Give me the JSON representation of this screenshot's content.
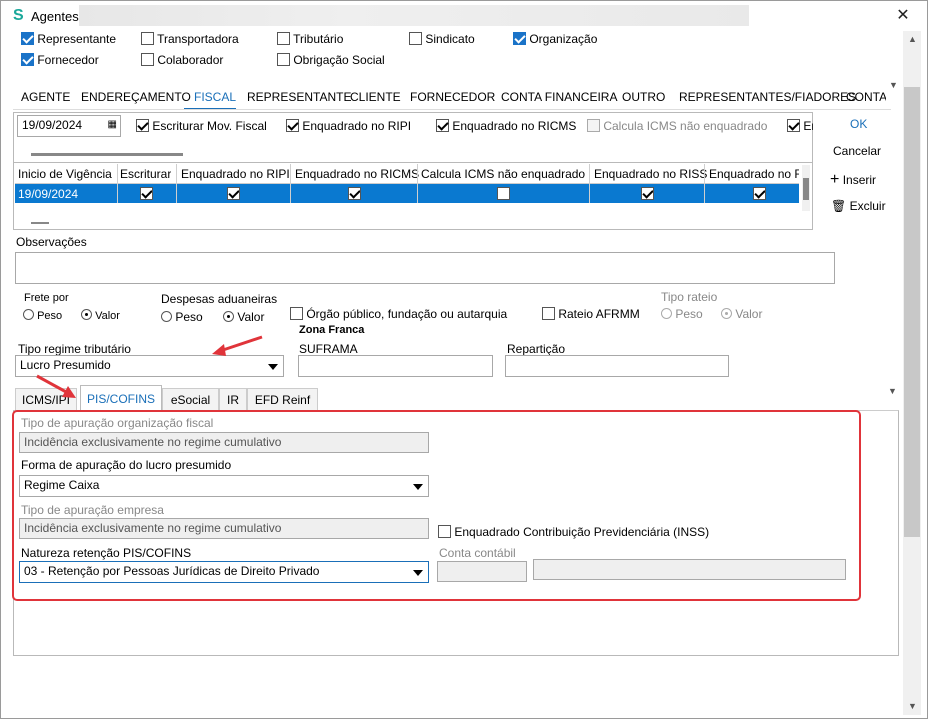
{
  "window": {
    "title": "Agentes"
  },
  "top_checks": [
    {
      "label": "Representante",
      "checked": true
    },
    {
      "label": "Transportadora",
      "checked": false
    },
    {
      "label": "Tributário",
      "checked": false
    },
    {
      "label": "Sindicato",
      "checked": false
    },
    {
      "label": "Organização",
      "checked": true
    },
    {
      "label": "Fornecedor",
      "checked": true
    },
    {
      "label": "Colaborador",
      "checked": false
    },
    {
      "label": "Obrigação Social",
      "checked": false
    }
  ],
  "tabs": [
    "AGENTE",
    "ENDEREÇAMENTO",
    "FISCAL",
    "REPRESENTANTE",
    "CLIENTE",
    "FORNECEDOR",
    "CONTA FINANCEIRA",
    "OUTRO",
    "REPRESENTANTES/FIADORES",
    "CONTAT"
  ],
  "active_tab": "FISCAL",
  "fiscal": {
    "date": "19/09/2024",
    "checks": [
      {
        "label": "Escriturar Mov. Fiscal",
        "checked": true
      },
      {
        "label": "Enquadrado no RIPI",
        "checked": true
      },
      {
        "label": "Enquadrado no RICMS",
        "checked": true
      },
      {
        "label": "Calcula ICMS não enquadrado",
        "checked": false,
        "disabled": true
      },
      {
        "label": "En",
        "checked": true
      }
    ]
  },
  "side_buttons": {
    "ok": "OK",
    "cancel": "Cancelar",
    "insert": "Inserir",
    "delete": "Excluir"
  },
  "grid": {
    "headers": [
      "Inicio de Vigência",
      "Escriturar",
      "Enquadrado no RIPI",
      "Enquadrado no RICMS",
      "Calcula ICMS não enquadrado",
      "Enquadrado no RISS",
      "Enquadrado no R"
    ],
    "row": {
      "date": "19/09/2024",
      "checks": [
        true,
        true,
        true,
        false,
        true,
        true
      ]
    }
  },
  "obs": {
    "label": "Observações",
    "value": ""
  },
  "frete": {
    "label": "Frete por",
    "opt1": "Peso",
    "opt2": "Valor",
    "selected": "Valor"
  },
  "despesas": {
    "label": "Despesas aduaneiras",
    "opt1": "Peso",
    "opt2": "Valor",
    "selected": "Valor"
  },
  "orgao": {
    "label": "Órgão público, fundação ou autarquia",
    "checked": false
  },
  "rateio_afrmm": {
    "label": "Rateio AFRMM",
    "checked": false
  },
  "tipo_rateio": {
    "label": "Tipo rateio",
    "opt1": "Peso",
    "opt2": "Valor",
    "selected": "Valor"
  },
  "zona_franca": {
    "label": "Zona Franca",
    "suframa_label": "SUFRAMA",
    "suframa": "",
    "reparticao_label": "Repartição",
    "reparticao": ""
  },
  "regime": {
    "label": "Tipo regime tributário",
    "value": "Lucro Presumido"
  },
  "subtabs": [
    "ICMS/IPI",
    "PIS/COFINS",
    "eSocial",
    "IR",
    "EFD Reinf"
  ],
  "active_subtab": "PIS/COFINS",
  "pis": {
    "org_label": "Tipo de apuração organização fiscal",
    "org_value": "Incidência exclusivamente no regime cumulativo",
    "forma_label": "Forma de apuração do lucro presumido",
    "forma_value": "Regime Caixa",
    "emp_label": "Tipo de apuração empresa",
    "emp_value": "Incidência exclusivamente no regime cumulativo",
    "inss_label": "Enquadrado Contribuição Previdenciária (INSS)",
    "inss_checked": false,
    "natureza_label": "Natureza retenção PIS/COFINS",
    "natureza_value": "03 - Retenção por Pessoas Jurídicas de Direito Privado",
    "conta_label": "Conta contábil",
    "conta_code": "",
    "conta_desc": ""
  },
  "colors": {
    "accent": "#1a6fb8",
    "selection": "#0a79d0",
    "highlight": "#e0343a",
    "checkbox": "#1a73c8"
  }
}
